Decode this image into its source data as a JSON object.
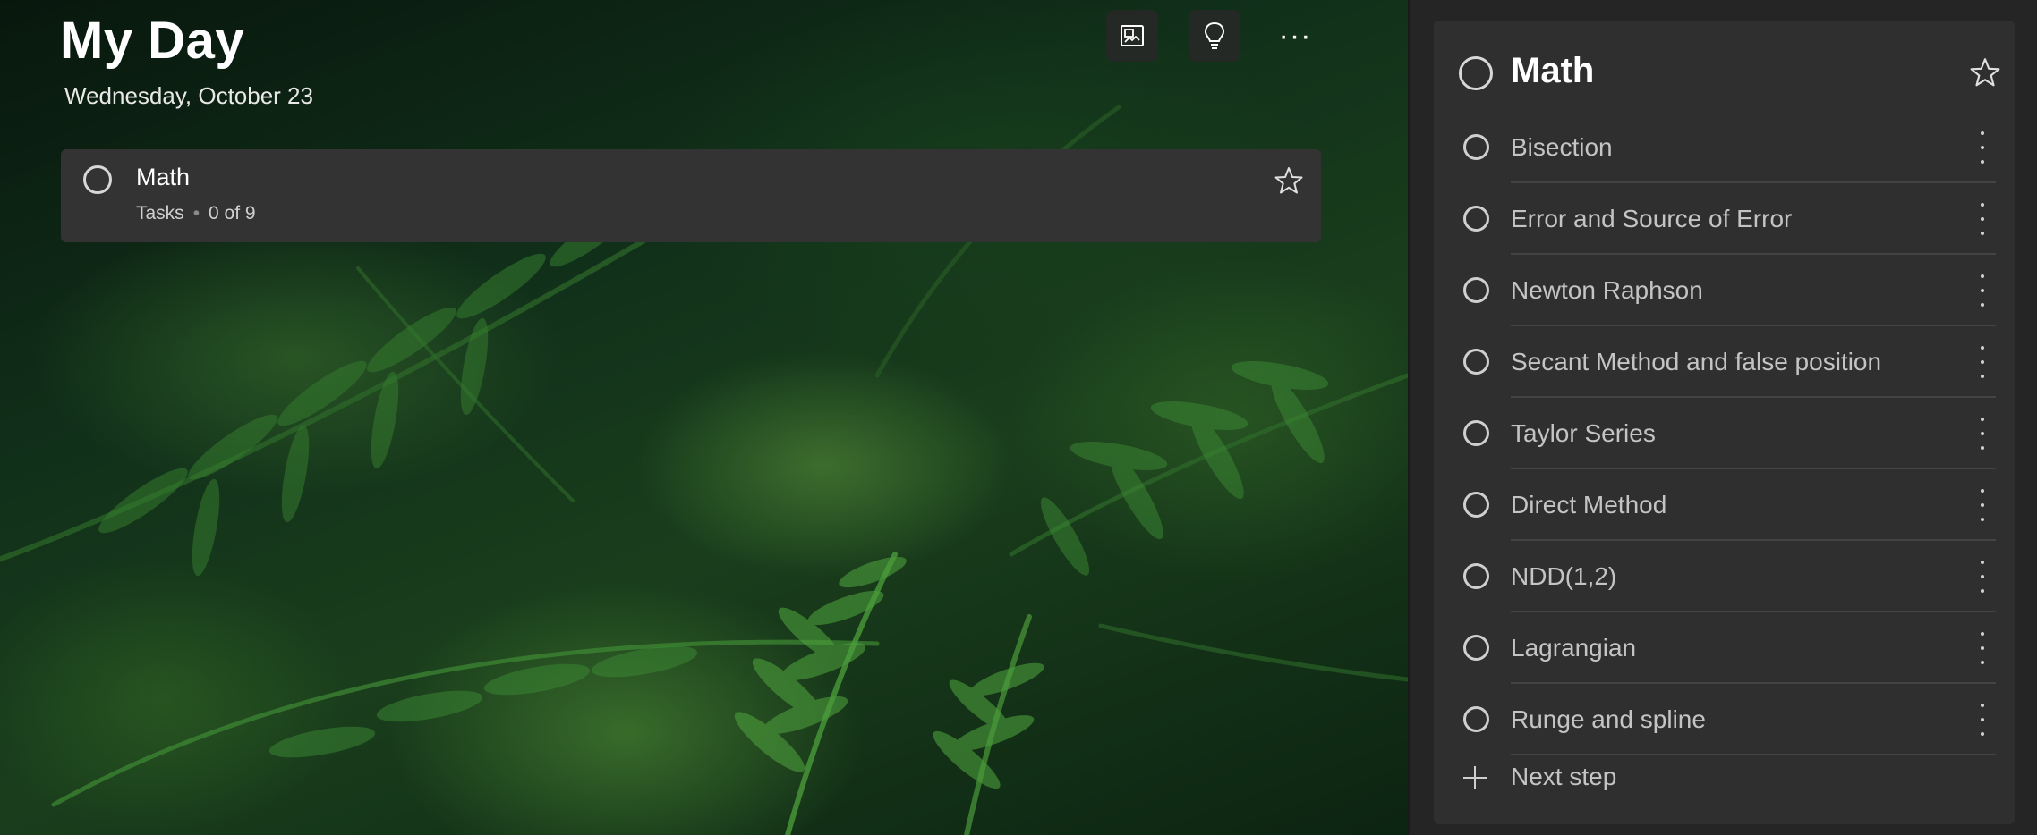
{
  "main": {
    "title": "My Day",
    "date": "Wednesday, October 23",
    "toolbar": {
      "background_icon": "background-picture-icon",
      "suggestions_icon": "lightbulb-icon",
      "more_label": "···"
    },
    "tasks": [
      {
        "title": "Math",
        "list_name": "Tasks",
        "progress": "0 of 9",
        "steps_done": 0,
        "steps_total": 9,
        "starred": false
      }
    ]
  },
  "detail": {
    "title": "Math",
    "starred": false,
    "steps": [
      {
        "label": "Bisection"
      },
      {
        "label": "Error and Source of Error"
      },
      {
        "label": "Newton Raphson"
      },
      {
        "label": "Secant Method and false position"
      },
      {
        "label": "Taylor Series"
      },
      {
        "label": "Direct Method"
      },
      {
        "label": "NDD(1,2)"
      },
      {
        "label": "Lagrangian"
      },
      {
        "label": "Runge and spline"
      }
    ],
    "next_step_label": "Next step"
  },
  "colors": {
    "card_bg": "#333333",
    "panel_bg": "#2f2f2f",
    "step_text": "#c4c4c4",
    "background_green": "#1a3e1c"
  }
}
